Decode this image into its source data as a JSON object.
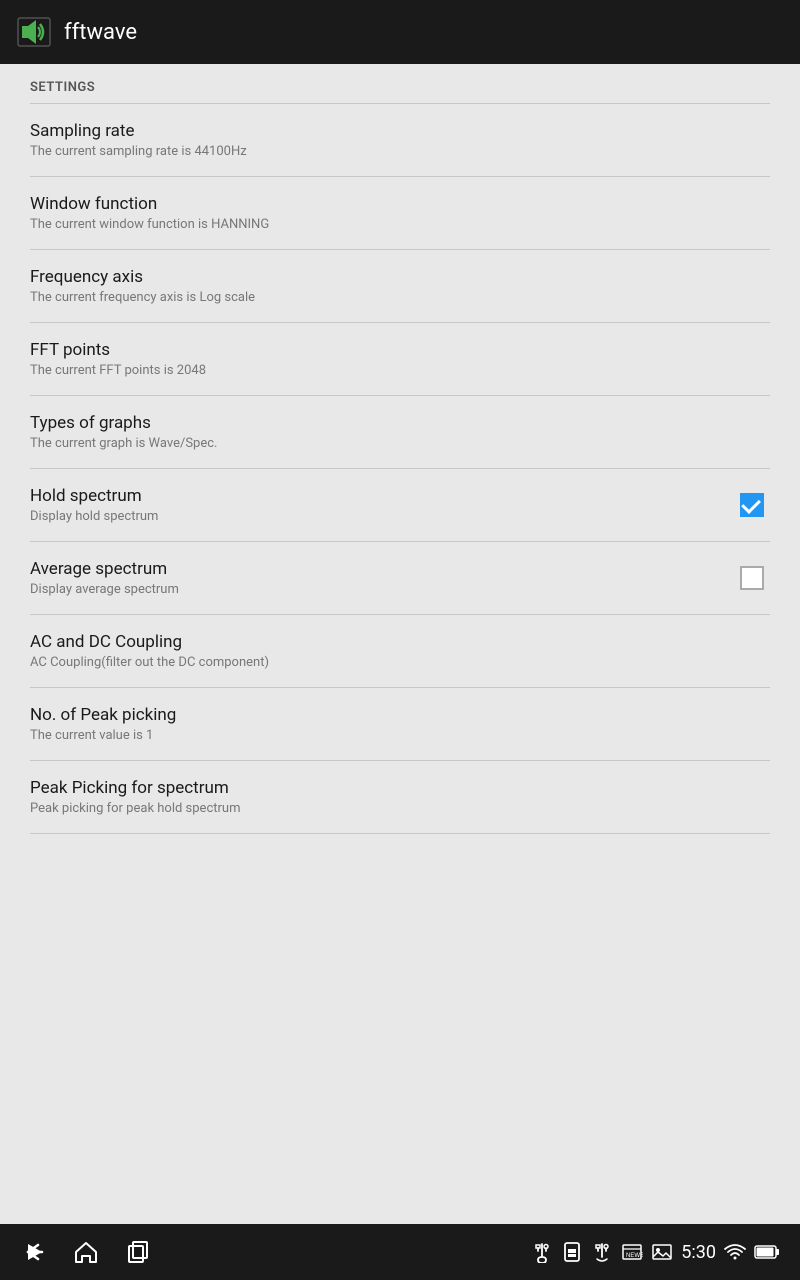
{
  "topbar": {
    "title": "fftwave"
  },
  "settings": {
    "section_label": "SETTINGS",
    "items": [
      {
        "id": "sampling-rate",
        "title": "Sampling rate",
        "subtitle": "The current sampling rate is 44100Hz",
        "has_checkbox": false
      },
      {
        "id": "window-function",
        "title": "Window function",
        "subtitle": "The current window function is HANNING",
        "has_checkbox": false
      },
      {
        "id": "frequency-axis",
        "title": "Frequency axis",
        "subtitle": "The current frequency axis is Log scale",
        "has_checkbox": false
      },
      {
        "id": "fft-points",
        "title": "FFT points",
        "subtitle": "The current FFT points is 2048",
        "has_checkbox": false
      },
      {
        "id": "types-of-graphs",
        "title": "Types of graphs",
        "subtitle": "The current graph is Wave/Spec.",
        "has_checkbox": false
      },
      {
        "id": "hold-spectrum",
        "title": "Hold spectrum",
        "subtitle": "Display hold spectrum",
        "has_checkbox": true,
        "checked": true
      },
      {
        "id": "average-spectrum",
        "title": "Average spectrum",
        "subtitle": "Display average spectrum",
        "has_checkbox": true,
        "checked": false
      },
      {
        "id": "ac-dc-coupling",
        "title": "AC and DC Coupling",
        "subtitle": "AC Coupling(filter out the DC component)",
        "has_checkbox": false
      },
      {
        "id": "peak-picking-count",
        "title": "No. of Peak picking",
        "subtitle": "The current value is 1",
        "has_checkbox": false
      },
      {
        "id": "peak-picking-spectrum",
        "title": "Peak Picking for spectrum",
        "subtitle": "Peak picking for peak hold spectrum",
        "has_checkbox": false
      }
    ]
  },
  "bottombar": {
    "time": "5:30",
    "nav_back_label": "back",
    "nav_home_label": "home",
    "nav_recents_label": "recents"
  }
}
